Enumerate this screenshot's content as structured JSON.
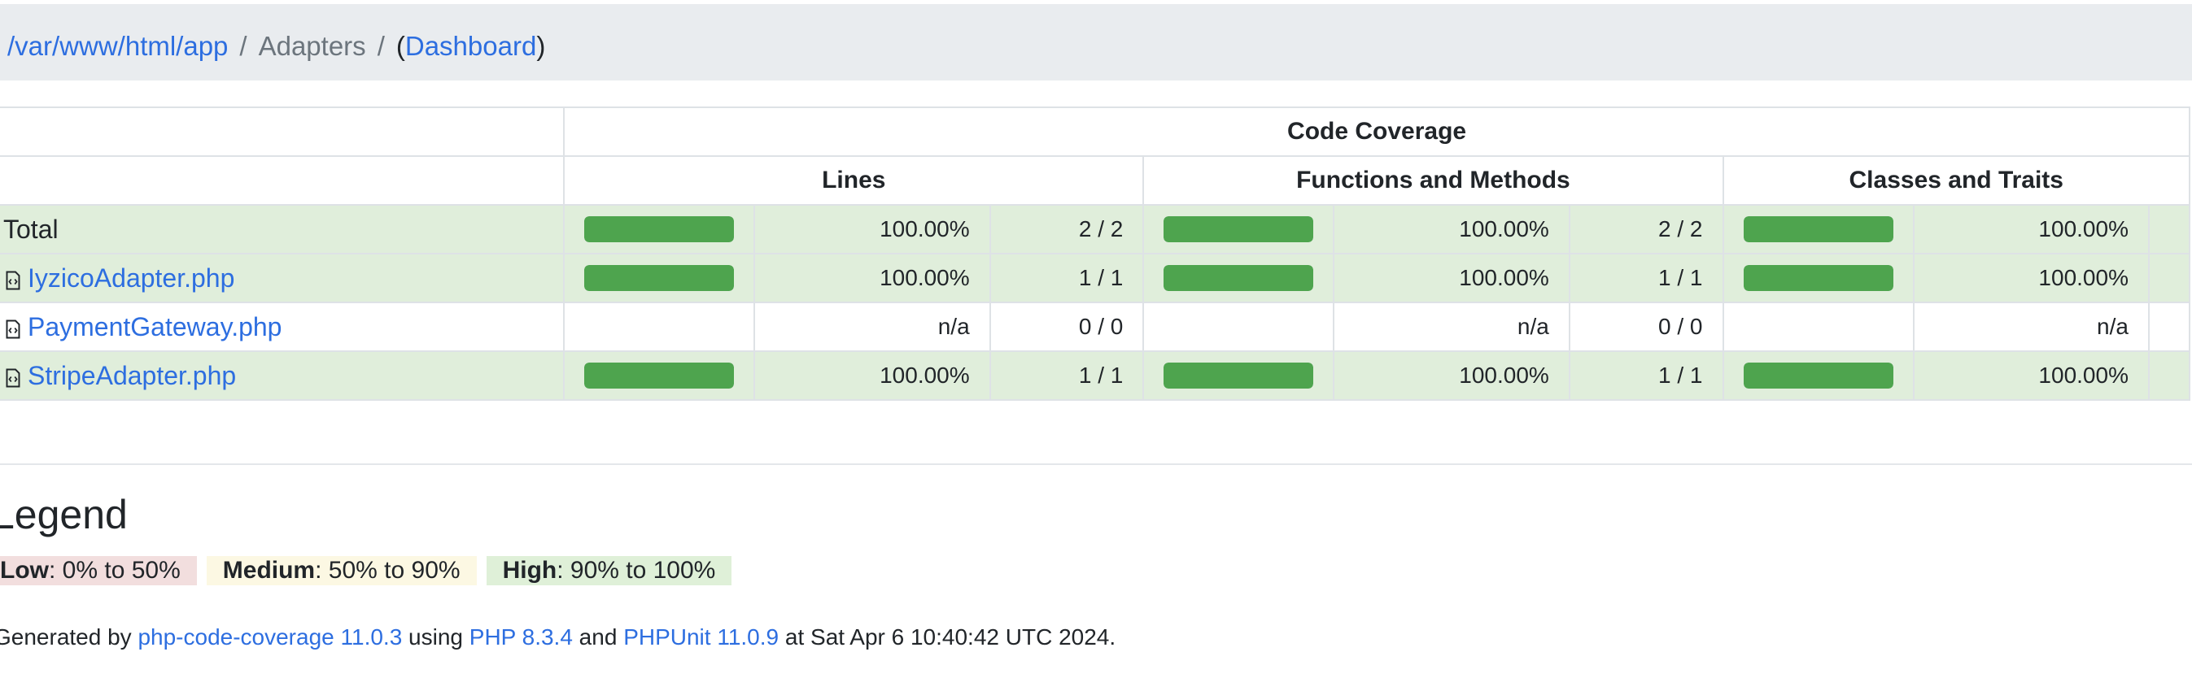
{
  "breadcrumb": {
    "root": "/var/www/html/app",
    "separator": "/",
    "current": "Adapters",
    "open_paren": "(",
    "dashboard": "Dashboard",
    "close_paren": ")"
  },
  "table": {
    "group_header": "Code Coverage",
    "columns": {
      "lines": "Lines",
      "functions": "Functions and Methods",
      "classes": "Classes and Traits"
    },
    "rows": [
      {
        "name": "Total",
        "is_file": false,
        "lines": {
          "progress": 100,
          "percent": "100.00%",
          "count": "2 / 2"
        },
        "functions": {
          "progress": 100,
          "percent": "100.00%",
          "count": "2 / 2"
        },
        "classes": {
          "progress": 100,
          "percent": "100.00%"
        }
      },
      {
        "name": "IyzicoAdapter.php",
        "is_file": true,
        "lines": {
          "progress": 100,
          "percent": "100.00%",
          "count": "1 / 1"
        },
        "functions": {
          "progress": 100,
          "percent": "100.00%",
          "count": "1 / 1"
        },
        "classes": {
          "progress": 100,
          "percent": "100.00%"
        }
      },
      {
        "name": "PaymentGateway.php",
        "is_file": true,
        "lines": {
          "progress": null,
          "percent": "n/a",
          "count": "0 / 0"
        },
        "functions": {
          "progress": null,
          "percent": "n/a",
          "count": "0 / 0"
        },
        "classes": {
          "progress": null,
          "percent": "n/a"
        }
      },
      {
        "name": "StripeAdapter.php",
        "is_file": true,
        "lines": {
          "progress": 100,
          "percent": "100.00%",
          "count": "1 / 1"
        },
        "functions": {
          "progress": 100,
          "percent": "100.00%",
          "count": "1 / 1"
        },
        "classes": {
          "progress": 100,
          "percent": "100.00%"
        }
      }
    ]
  },
  "legend": {
    "title": "Legend",
    "low_label": "Low",
    "low_range": ": 0% to 50%",
    "medium_label": "Medium",
    "medium_range": ": 50% to 90%",
    "high_label": "High",
    "high_range": ": 90% to 100%"
  },
  "footer": {
    "prefix": "Generated by ",
    "tool": "php-code-coverage 11.0.3",
    "using": " using ",
    "php": "PHP 8.3.4",
    "and": " and ",
    "phpunit": "PHPUnit 11.0.9",
    "suffix": " at Sat Apr 6 10:40:42 UTC 2024."
  },
  "colors": {
    "bar_success": "#4ea44e",
    "row_success_bg": "#e0eedb",
    "link": "#2d6ee0"
  },
  "icons": {
    "file": "file-code-icon"
  }
}
